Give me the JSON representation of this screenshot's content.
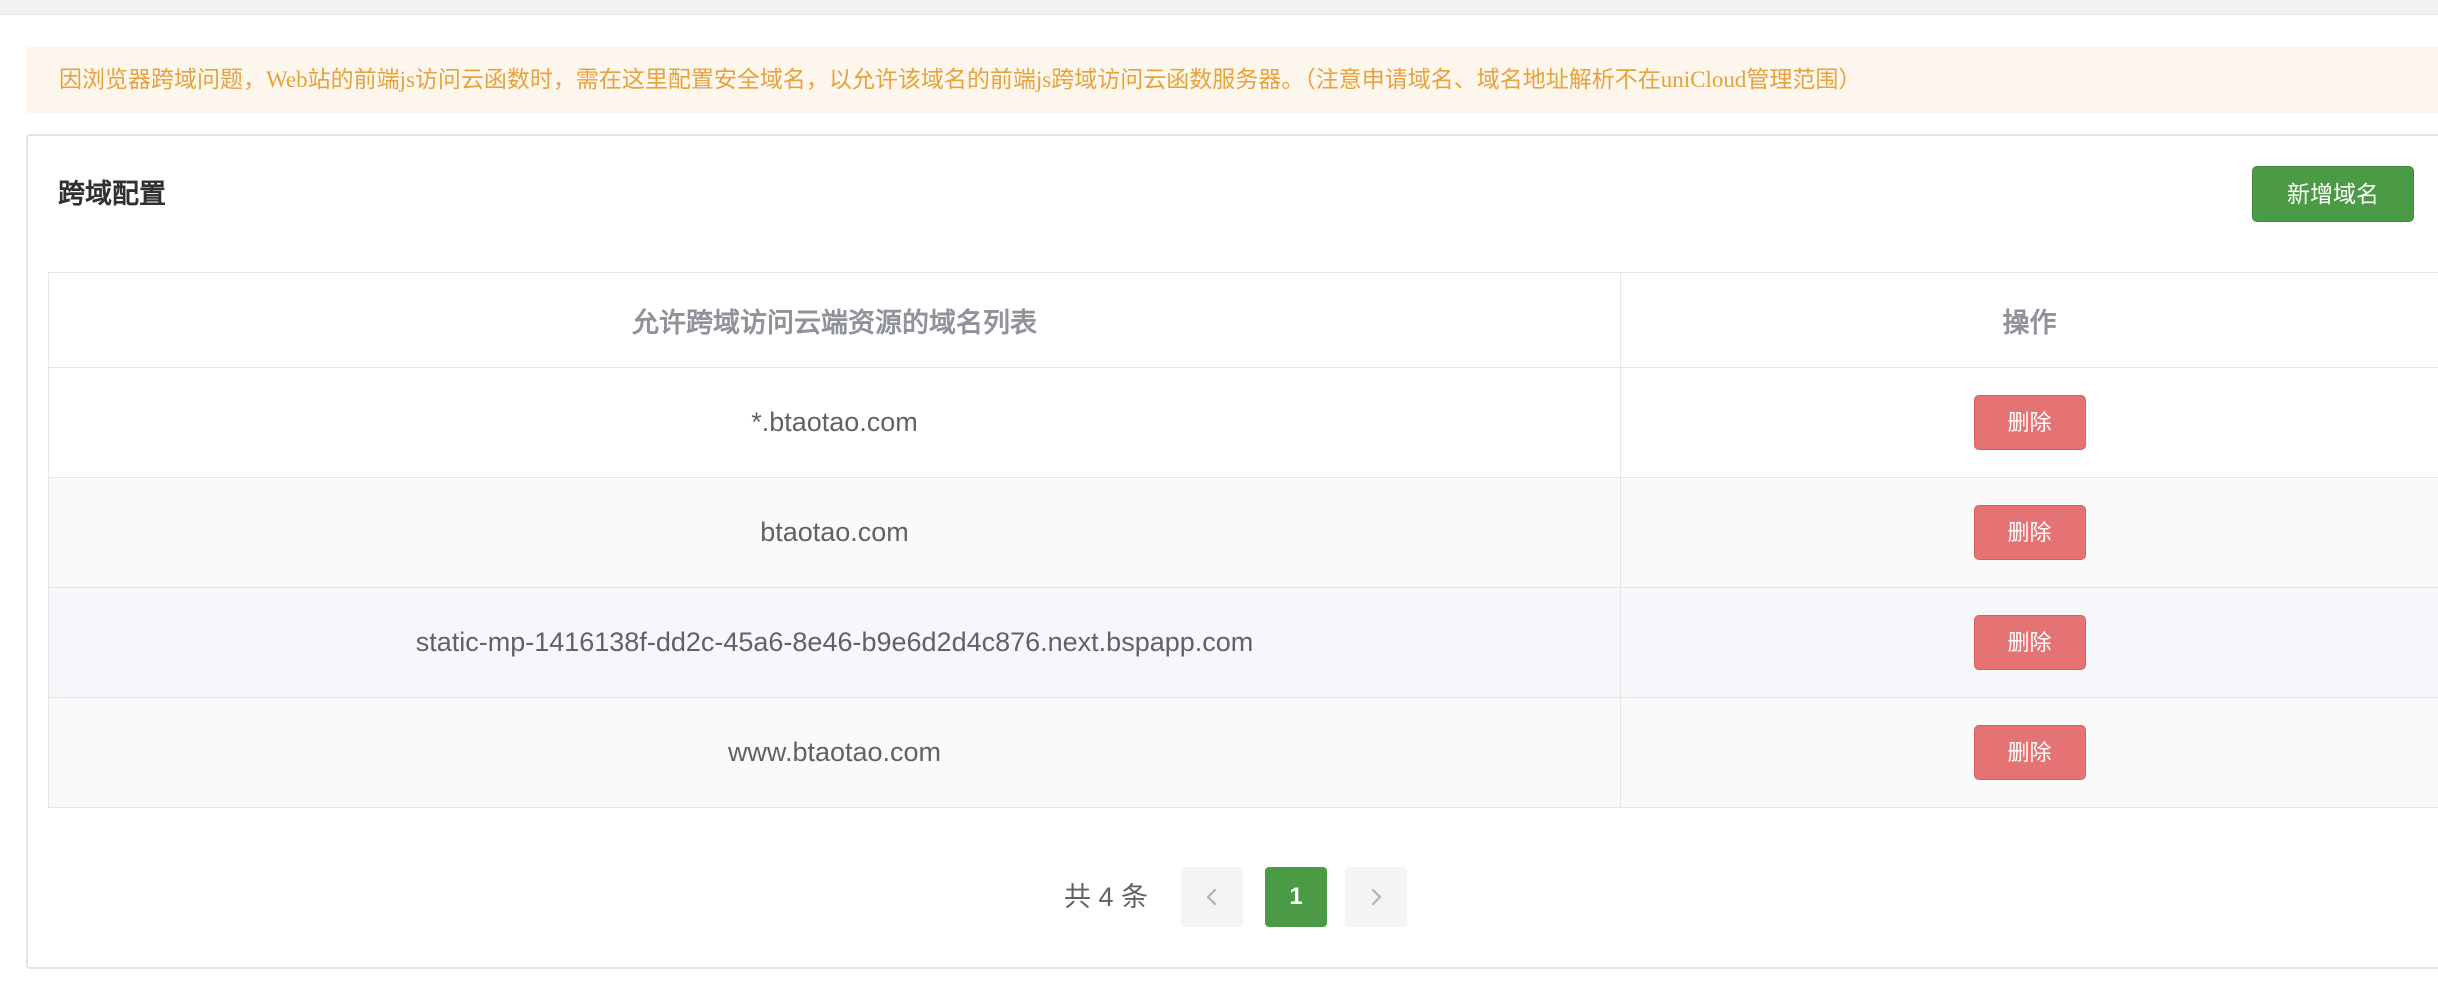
{
  "notice": {
    "text": "因浏览器跨域问题，Web站的前端js访问云函数时，需在这里配置安全域名，以允许该域名的前端js跨域访问云函数服务器。（注意申请域名、域名地址解析不在uniCloud管理范围）",
    "color": "#e6a23c",
    "background": "#fdf6ec"
  },
  "card": {
    "title": "跨域配置",
    "add_button_label": "新增域名"
  },
  "table": {
    "headers": [
      "允许跨域访问云端资源的域名列表",
      "操作"
    ],
    "rows": [
      {
        "domain": "*.btaotao.com",
        "action_label": "删除"
      },
      {
        "domain": "btaotao.com",
        "action_label": "删除"
      },
      {
        "domain": "static-mp-1416138f-dd2c-45a6-8e46-b9e6d2d4c876.next.bspapp.com",
        "action_label": "删除"
      },
      {
        "domain": "www.btaotao.com",
        "action_label": "删除"
      }
    ]
  },
  "pagination": {
    "total_text": "共 4 条",
    "current_page": "1",
    "prev_icon": "chevron-left-icon",
    "next_icon": "chevron-right-icon"
  },
  "colors": {
    "primary_green": "#4a9a46",
    "danger_red": "#e57373"
  }
}
